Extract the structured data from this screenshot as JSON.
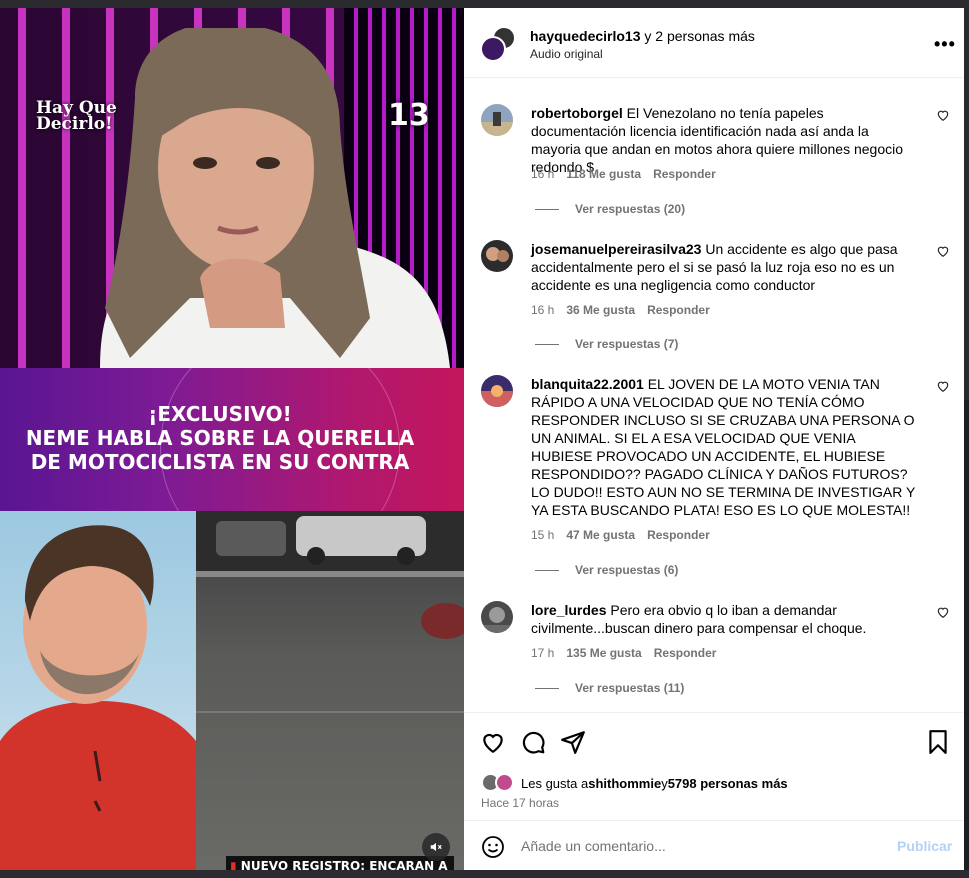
{
  "media": {
    "show_logo": "Hay Que\nDecirlo!",
    "channel_logo": "13",
    "banner_line1": "¡EXCLUSIVO!",
    "banner_line2": "NEME HABLA SOBRE LA QUERELLA",
    "banner_line3": "DE MOTOCICLISTA EN SU CONTRA",
    "street_caption": "NUEVO REGISTRO: ENCARAN A",
    "mute_icon": "speaker-muted-icon"
  },
  "header": {
    "username": "hayquedecirlo13",
    "title_suffix": " y 2 personas más",
    "subtitle": "Audio original",
    "more_icon": "more-horizontal-icon",
    "more_label": "•••"
  },
  "comments": [
    {
      "user": "robertoborgel",
      "text": "El Venezolano no tenía papeles documentación licencia identificación nada así anda la mayoria que andan en motos ahora quiere millones negocio redondo $",
      "time": "16 h",
      "likes": "118 Me gusta",
      "reply": "Responder",
      "replies": "Ver respuestas (20)"
    },
    {
      "user": "josemanuelpereirasilva23",
      "text": "Un accidente es algo que pasa accidentalmente pero el si se pasó la luz roja eso no es un accidente es una negligencia como conductor",
      "time": "16 h",
      "likes": "36 Me gusta",
      "reply": "Responder",
      "replies": "Ver respuestas (7)"
    },
    {
      "user": "blanquita22.2001",
      "text": "EL JOVEN DE LA MOTO VENIA TAN RÁPIDO A UNA VELOCIDAD QUE NO TENÍA CÓMO RESPONDER INCLUSO SI SE CRUZABA UNA PERSONA O UN ANIMAL. SI EL A ESA VELOCIDAD QUE VENIA HUBIESE PROVOCADO UN ACCIDENTE, EL HUBIESE RESPONDIDO?? PAGADO CLÍNICA Y DAÑOS FUTUROS? LO DUDO!! ESTO AUN NO SE TERMINA DE INVESTIGAR Y YA ESTA BUSCANDO PLATA! ESO ES LO QUE MOLESTA!!",
      "time": "15 h",
      "likes": "47 Me gusta",
      "reply": "Responder",
      "replies": "Ver respuestas (6)"
    },
    {
      "user": "lore_lurdes",
      "text": "Pero era obvio q lo iban a demandar civilmente...buscan dinero para compensar el choque.",
      "time": "17 h",
      "likes": "135 Me gusta",
      "reply": "Responder",
      "replies": "Ver respuestas (11)"
    }
  ],
  "actions": {
    "like_icon": "heart-icon",
    "comment_icon": "comment-icon",
    "share_icon": "send-icon",
    "save_icon": "bookmark-icon",
    "likes_prefix": "Les gusta a ",
    "likes_user": "shithommie",
    "likes_middle": " y ",
    "likes_count": "5798 personas más",
    "time_ago": "Hace 17 horas"
  },
  "composer": {
    "emoji_icon": "smiley-icon",
    "placeholder": "Añade un comentario...",
    "publish_label": "Publicar"
  },
  "colors": {
    "link_blue_disabled": "#b3d2f5",
    "muted_text": "#737373",
    "banner_start": "#5a1592",
    "banner_end": "#c4165c"
  }
}
